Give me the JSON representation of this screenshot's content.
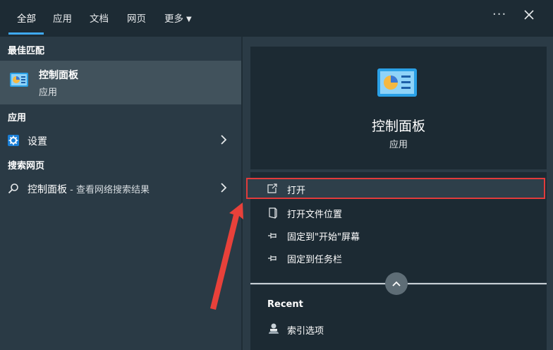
{
  "tabs": [
    {
      "label": "全部",
      "active": true
    },
    {
      "label": "应用"
    },
    {
      "label": "文档"
    },
    {
      "label": "网页"
    },
    {
      "label": "更多"
    }
  ],
  "window_controls": {
    "more_icon": "more-dots-icon",
    "close_icon": "close-icon"
  },
  "left": {
    "best_match_header": "最佳匹配",
    "best_match": {
      "title": "控制面板",
      "subtitle": "应用",
      "icon": "control-panel-icon"
    },
    "apps_header": "应用",
    "apps": [
      {
        "label": "设置",
        "icon": "gear-icon"
      }
    ],
    "web_header": "搜索网页",
    "web": [
      {
        "label": "控制面板",
        "suffix": " - 查看网络搜索结果",
        "icon": "search-icon"
      }
    ]
  },
  "right": {
    "title": "控制面板",
    "subtitle": "应用",
    "actions": [
      {
        "label": "打开",
        "icon": "open-icon",
        "highlighted": true
      },
      {
        "label": "打开文件位置",
        "icon": "file-location-icon"
      },
      {
        "label": "固定到\"开始\"屏幕",
        "icon": "pin-icon"
      },
      {
        "label": "固定到任务栏",
        "icon": "pin-icon"
      }
    ],
    "recent_header": "Recent",
    "recent": [
      {
        "label": "索引选项",
        "icon": "indexing-options-icon"
      }
    ]
  },
  "colors": {
    "accent": "#3fa9f5",
    "highlight_border": "#e23b3b",
    "annotation_arrow": "#e8413a"
  }
}
